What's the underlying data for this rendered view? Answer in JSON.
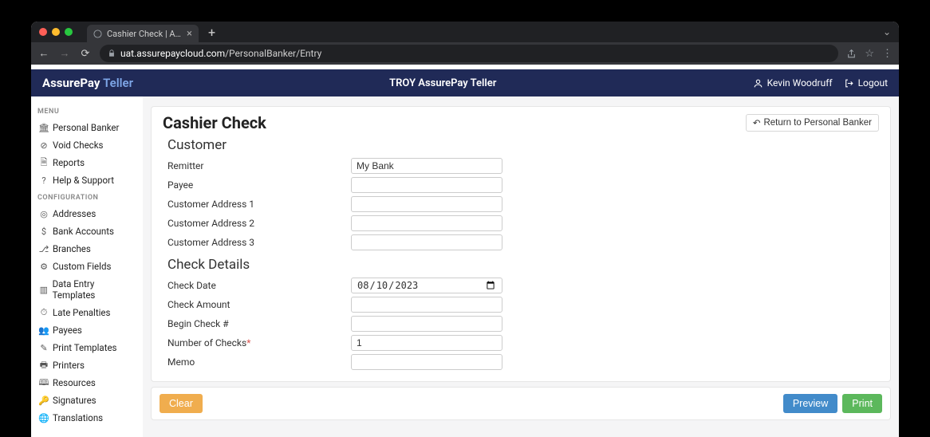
{
  "browser": {
    "tab_title": "Cashier Check | AssurePayClo…",
    "url_domain": "uat.assurepaycloud.com",
    "url_path": "/PersonalBanker/Entry"
  },
  "header": {
    "brand1": "AssurePay",
    "brand2": "Teller",
    "center": "TROY AssurePay Teller",
    "user": "Kevin Woodruff",
    "logout": "Logout"
  },
  "sidebar": {
    "menu_head": "MENU",
    "menu": [
      {
        "label": "Personal Banker"
      },
      {
        "label": "Void Checks"
      },
      {
        "label": "Reports"
      },
      {
        "label": "Help & Support"
      }
    ],
    "config_head": "CONFIGURATION",
    "config": [
      {
        "label": "Addresses"
      },
      {
        "label": "Bank Accounts"
      },
      {
        "label": "Branches"
      },
      {
        "label": "Custom Fields"
      },
      {
        "label": "Data Entry Templates"
      },
      {
        "label": "Late Penalties"
      },
      {
        "label": "Payees"
      },
      {
        "label": "Print Templates"
      },
      {
        "label": "Printers"
      },
      {
        "label": "Resources"
      },
      {
        "label": "Signatures"
      },
      {
        "label": "Translations"
      }
    ]
  },
  "page": {
    "title": "Cashier Check",
    "return_label": "Return to Personal Banker",
    "customer_head": "Customer",
    "check_head": "Check Details",
    "labels": {
      "remitter": "Remitter",
      "payee": "Payee",
      "addr1": "Customer Address 1",
      "addr2": "Customer Address 2",
      "addr3": "Customer Address 3",
      "check_date": "Check Date",
      "check_amount": "Check Amount",
      "begin_check": "Begin Check #",
      "num_checks": "Number of Checks",
      "memo": "Memo"
    },
    "values": {
      "remitter": "My Bank",
      "payee": "",
      "addr1": "",
      "addr2": "",
      "addr3": "",
      "check_date": "2023-08-10",
      "check_amount": "",
      "begin_check": "",
      "num_checks": "1",
      "memo": ""
    },
    "buttons": {
      "clear": "Clear",
      "preview": "Preview",
      "print": "Print"
    }
  }
}
